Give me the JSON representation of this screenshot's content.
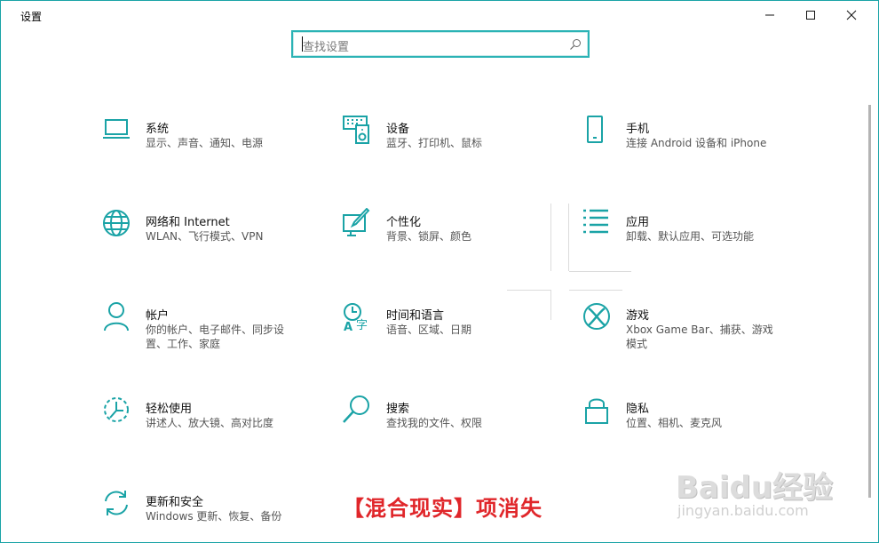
{
  "window": {
    "title": "设置"
  },
  "search": {
    "placeholder": "查找设置"
  },
  "tiles": [
    {
      "name": "系统",
      "desc": "显示、声音、通知、电源",
      "icon": "laptop-icon"
    },
    {
      "name": "设备",
      "desc": "蓝牙、打印机、鼠标",
      "icon": "keyboard-speaker-icon"
    },
    {
      "name": "手机",
      "desc": "连接 Android 设备和 iPhone",
      "icon": "phone-icon"
    },
    {
      "name": "网络和 Internet",
      "desc": "WLAN、飞行模式、VPN",
      "icon": "globe-icon"
    },
    {
      "name": "个性化",
      "desc": "背景、锁屏、颜色",
      "icon": "paint-icon"
    },
    {
      "name": "应用",
      "desc": "卸载、默认应用、可选功能",
      "icon": "apps-list-icon"
    },
    {
      "name": "帐户",
      "desc": "你的帐户、电子邮件、同步设置、工作、家庭",
      "icon": "person-icon"
    },
    {
      "name": "时间和语言",
      "desc": "语音、区域、日期",
      "icon": "time-language-icon"
    },
    {
      "name": "游戏",
      "desc": "Xbox Game Bar、捕获、游戏模式",
      "icon": "xbox-icon"
    },
    {
      "name": "轻松使用",
      "desc": "讲述人、放大镜、高对比度",
      "icon": "ease-of-access-icon"
    },
    {
      "name": "搜索",
      "desc": "查找我的文件、权限",
      "icon": "search-magnifier-icon"
    },
    {
      "name": "隐私",
      "desc": "位置、相机、麦克风",
      "icon": "lock-icon"
    },
    {
      "name": "更新和安全",
      "desc": "Windows 更新、恢复、备份",
      "icon": "sync-icon"
    }
  ],
  "overlay": {
    "caption": "【混合现实】项消失",
    "watermark_logo": "Baidu经验",
    "watermark_url": "jingyan.baidu.com"
  },
  "colors": {
    "accent": "#1aa3a6",
    "caption": "#e0262a"
  }
}
